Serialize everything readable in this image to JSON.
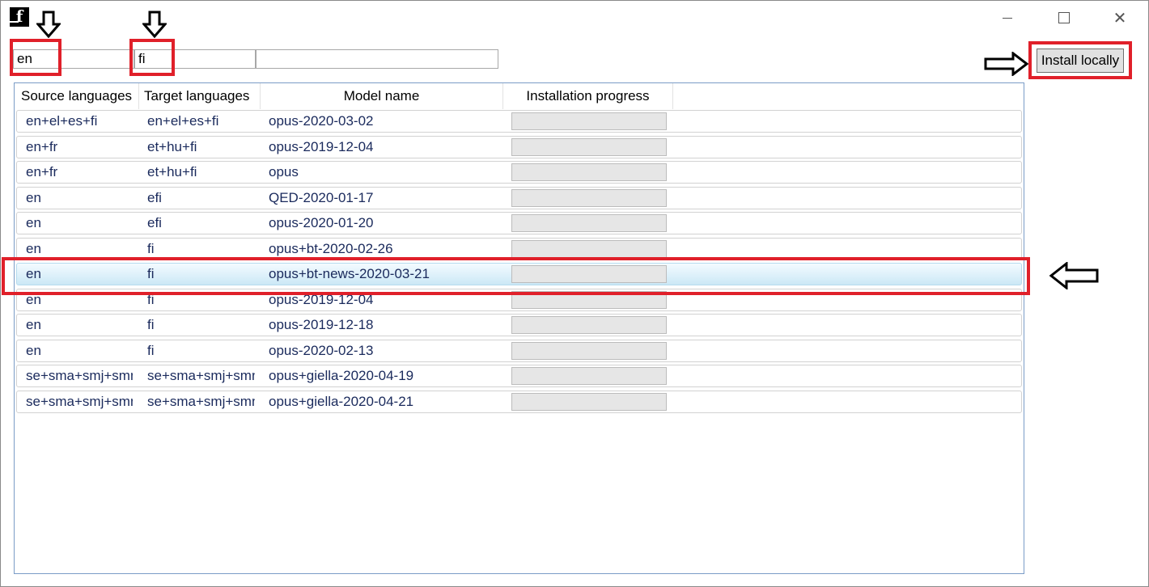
{
  "window": {
    "app_icon": "f",
    "controls": {
      "minimize": "minimize-icon",
      "maximize": "maximize-icon",
      "close": "close-icon"
    }
  },
  "filters": {
    "source": {
      "value": "en"
    },
    "target": {
      "value": "fi"
    },
    "model_name": {
      "value": ""
    }
  },
  "install_button": {
    "label": "Install locally"
  },
  "table": {
    "headers": [
      "Source languages",
      "Target languages",
      "Model name",
      "Installation progress"
    ],
    "rows": [
      {
        "source": "en+el+es+fi",
        "target": "en+el+es+fi",
        "model": "opus-2020-03-02",
        "progress": 0
      },
      {
        "source": "en+fr",
        "target": "et+hu+fi",
        "model": "opus-2019-12-04",
        "progress": 0
      },
      {
        "source": "en+fr",
        "target": "et+hu+fi",
        "model": "opus",
        "progress": 0
      },
      {
        "source": "en",
        "target": "efi",
        "model": "QED-2020-01-17",
        "progress": 0
      },
      {
        "source": "en",
        "target": "efi",
        "model": "opus-2020-01-20",
        "progress": 0
      },
      {
        "source": "en",
        "target": "fi",
        "model": "opus+bt-2020-02-26",
        "progress": 0
      },
      {
        "source": "en",
        "target": "fi",
        "model": "opus+bt-news-2020-03-21",
        "progress": 0,
        "selected": true
      },
      {
        "source": "en",
        "target": "fi",
        "model": "opus-2019-12-04",
        "progress": 0
      },
      {
        "source": "en",
        "target": "fi",
        "model": "opus-2019-12-18",
        "progress": 0
      },
      {
        "source": "en",
        "target": "fi",
        "model": "opus-2020-02-13",
        "progress": 0
      },
      {
        "source": "se+sma+smj+smn",
        "target": "se+sma+smj+smn",
        "model": "opus+giella-2020-04-19",
        "progress": 0
      },
      {
        "source": "se+sma+smj+smn",
        "target": "se+sma+smj+smn",
        "model": "opus+giella-2020-04-21",
        "progress": 0
      }
    ]
  },
  "annotation_color": "#e0202a"
}
